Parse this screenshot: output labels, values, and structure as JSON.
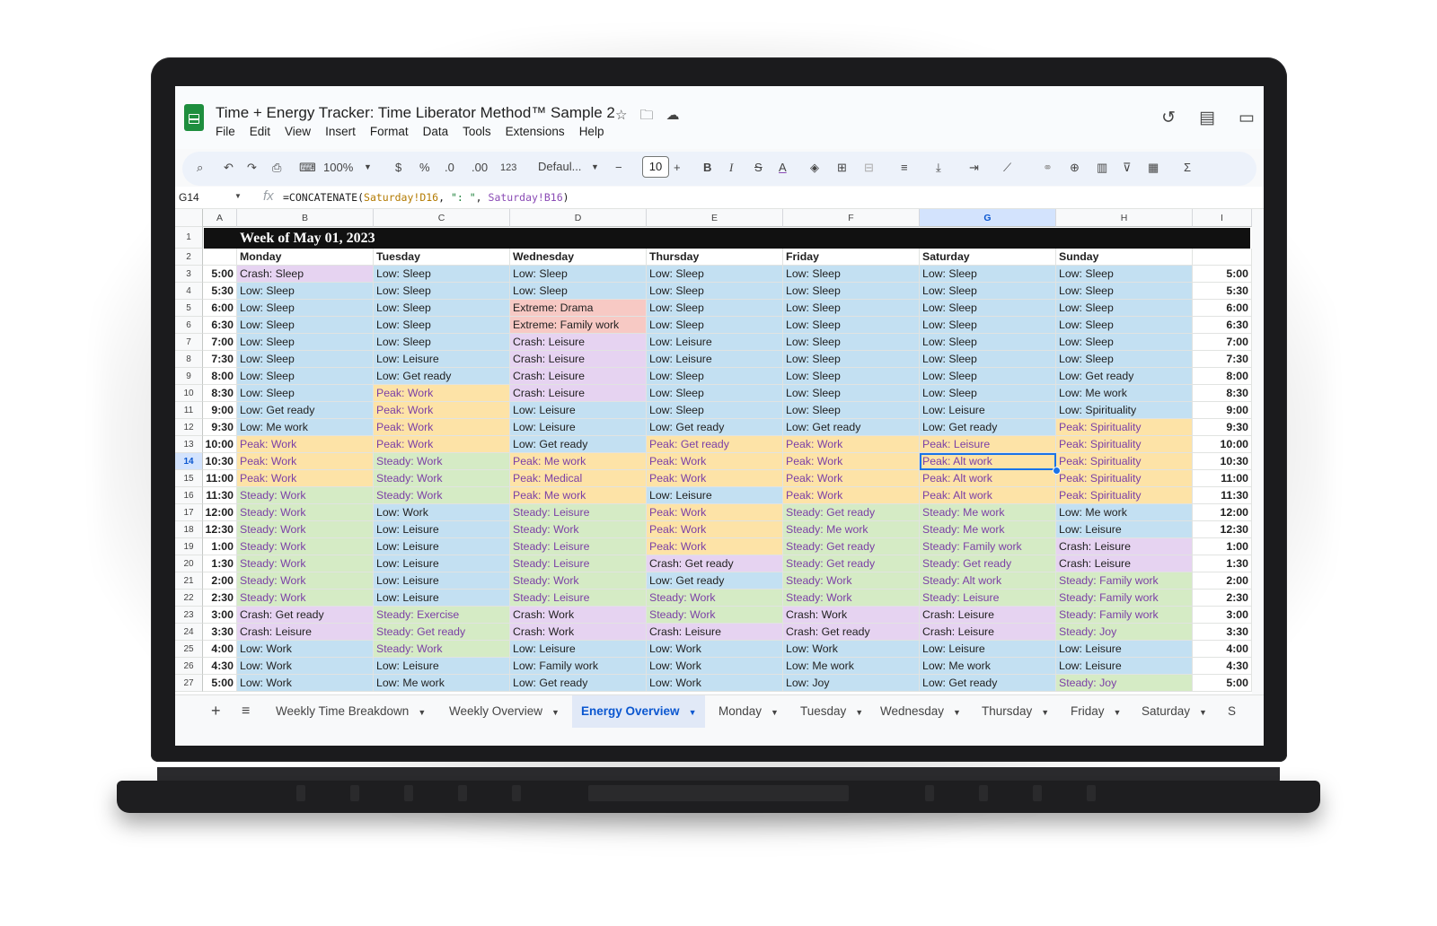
{
  "app": {
    "doc_title": "Time + Energy Tracker: Time Liberator Method™ Sample 2",
    "menu": [
      "File",
      "Edit",
      "View",
      "Insert",
      "Format",
      "Data",
      "Tools",
      "Extensions",
      "Help"
    ]
  },
  "toolbar": {
    "zoom": "100%",
    "currency": "$",
    "percent": "%",
    "decrease_decimal": ".0",
    "increase_decimal": ".00",
    "number_format": "123",
    "font": "Defaul...",
    "font_size": "10",
    "bold": "B",
    "italic": "I",
    "strike": "S",
    "text_color": "A",
    "sum": "Σ"
  },
  "formula_bar": {
    "name_box": "G14",
    "fx": "fx",
    "formula_prefix": "=CONCATENATE(",
    "ref1": "Saturday!D16",
    "sep1": ", ",
    "str": "\": \"",
    "sep2": ", ",
    "ref2": "Saturday!B16",
    "formula_suffix": ")"
  },
  "grid": {
    "columns": [
      "A",
      "B",
      "C",
      "D",
      "E",
      "F",
      "G",
      "H",
      "I"
    ],
    "selected_column": "G",
    "selected_row": "14",
    "banner": "Week of May 01, 2023",
    "days": [
      "Monday",
      "Tuesday",
      "Wednesday",
      "Thursday",
      "Friday",
      "Saturday",
      "Sunday"
    ],
    "rows": [
      {
        "n": "3",
        "time": "5:00",
        "cells": [
          "Crash: Sleep",
          "Low: Sleep",
          "Low: Sleep",
          "Low: Sleep",
          "Low: Sleep",
          "Low: Sleep",
          "Low: Sleep"
        ]
      },
      {
        "n": "4",
        "time": "5:30",
        "cells": [
          "Low: Sleep",
          "Low: Sleep",
          "Low: Sleep",
          "Low: Sleep",
          "Low: Sleep",
          "Low: Sleep",
          "Low: Sleep"
        ]
      },
      {
        "n": "5",
        "time": "6:00",
        "cells": [
          "Low: Sleep",
          "Low: Sleep",
          "Extreme: Drama",
          "Low: Sleep",
          "Low: Sleep",
          "Low: Sleep",
          "Low: Sleep"
        ]
      },
      {
        "n": "6",
        "time": "6:30",
        "cells": [
          "Low: Sleep",
          "Low: Sleep",
          "Extreme: Family work",
          "Low: Sleep",
          "Low: Sleep",
          "Low: Sleep",
          "Low: Sleep"
        ]
      },
      {
        "n": "7",
        "time": "7:00",
        "cells": [
          "Low: Sleep",
          "Low: Sleep",
          "Crash: Leisure",
          "Low: Leisure",
          "Low: Sleep",
          "Low: Sleep",
          "Low: Sleep"
        ]
      },
      {
        "n": "8",
        "time": "7:30",
        "cells": [
          "Low: Sleep",
          "Low: Leisure",
          "Crash: Leisure",
          "Low: Leisure",
          "Low: Sleep",
          "Low: Sleep",
          "Low: Sleep"
        ]
      },
      {
        "n": "9",
        "time": "8:00",
        "cells": [
          "Low: Sleep",
          "Low: Get ready",
          "Crash: Leisure",
          "Low: Sleep",
          "Low: Sleep",
          "Low: Sleep",
          "Low: Get ready"
        ]
      },
      {
        "n": "10",
        "time": "8:30",
        "cells": [
          "Low: Sleep",
          "Peak: Work",
          "Crash: Leisure",
          "Low: Sleep",
          "Low: Sleep",
          "Low: Sleep",
          "Low: Me work"
        ]
      },
      {
        "n": "11",
        "time": "9:00",
        "cells": [
          "Low: Get ready",
          "Peak: Work",
          "Low: Leisure",
          "Low: Sleep",
          "Low: Sleep",
          "Low: Leisure",
          "Low: Spirituality"
        ]
      },
      {
        "n": "12",
        "time": "9:30",
        "cells": [
          "Low: Me work",
          "Peak: Work",
          "Low: Leisure",
          "Low: Get ready",
          "Low: Get ready",
          "Low: Get ready",
          "Peak: Spirituality"
        ]
      },
      {
        "n": "13",
        "time": "10:00",
        "cells": [
          "Peak: Work",
          "Peak: Work",
          "Low: Get ready",
          "Peak: Get ready",
          "Peak: Work",
          "Peak: Leisure",
          "Peak: Spirituality"
        ]
      },
      {
        "n": "14",
        "time": "10:30",
        "cells": [
          "Peak: Work",
          "Steady: Work",
          "Peak: Me work",
          "Peak: Work",
          "Peak: Work",
          "Peak: Alt work",
          "Peak: Spirituality"
        ]
      },
      {
        "n": "15",
        "time": "11:00",
        "cells": [
          "Peak: Work",
          "Steady: Work",
          "Peak: Medical",
          "Peak: Work",
          "Peak: Work",
          "Peak: Alt work",
          "Peak: Spirituality"
        ]
      },
      {
        "n": "16",
        "time": "11:30",
        "cells": [
          "Steady: Work",
          "Steady: Work",
          "Peak: Me work",
          "Low: Leisure",
          "Peak: Work",
          "Peak: Alt work",
          "Peak: Spirituality"
        ]
      },
      {
        "n": "17",
        "time": "12:00",
        "cells": [
          "Steady: Work",
          "Low: Work",
          "Steady: Leisure",
          "Peak: Work",
          "Steady: Get ready",
          "Steady: Me work",
          "Low: Me work"
        ]
      },
      {
        "n": "18",
        "time": "12:30",
        "cells": [
          "Steady: Work",
          "Low: Leisure",
          "Steady: Work",
          "Peak: Work",
          "Steady: Me work",
          "Steady: Me work",
          "Low: Leisure"
        ]
      },
      {
        "n": "19",
        "time": "1:00",
        "cells": [
          "Steady: Work",
          "Low: Leisure",
          "Steady: Leisure",
          "Peak: Work",
          "Steady: Get ready",
          "Steady: Family work",
          "Crash: Leisure"
        ]
      },
      {
        "n": "20",
        "time": "1:30",
        "cells": [
          "Steady: Work",
          "Low: Leisure",
          "Steady: Leisure",
          "Crash: Get ready",
          "Steady: Get ready",
          "Steady: Get ready",
          "Crash: Leisure"
        ]
      },
      {
        "n": "21",
        "time": "2:00",
        "cells": [
          "Steady: Work",
          "Low: Leisure",
          "Steady: Work",
          "Low: Get ready",
          "Steady: Work",
          "Steady: Alt work",
          "Steady: Family work"
        ]
      },
      {
        "n": "22",
        "time": "2:30",
        "cells": [
          "Steady: Work",
          "Low: Leisure",
          "Steady: Leisure",
          "Steady: Work",
          "Steady: Work",
          "Steady: Leisure",
          "Steady: Family work"
        ]
      },
      {
        "n": "23",
        "time": "3:00",
        "cells": [
          "Crash: Get ready",
          "Steady: Exercise",
          "Crash: Work",
          "Steady: Work",
          "Crash: Work",
          "Crash: Leisure",
          "Steady: Family work"
        ]
      },
      {
        "n": "24",
        "time": "3:30",
        "cells": [
          "Crash: Leisure",
          "Steady: Get ready",
          "Crash: Work",
          "Crash: Leisure",
          "Crash: Get ready",
          "Crash: Leisure",
          "Steady: Joy"
        ]
      },
      {
        "n": "25",
        "time": "4:00",
        "cells": [
          "Low: Work",
          "Steady: Work",
          "Low: Leisure",
          "Low: Work",
          "Low: Work",
          "Low: Leisure",
          "Low: Leisure"
        ]
      },
      {
        "n": "26",
        "time": "4:30",
        "cells": [
          "Low: Work",
          "Low: Leisure",
          "Low: Family work",
          "Low: Work",
          "Low: Me work",
          "Low: Me work",
          "Low: Leisure"
        ]
      },
      {
        "n": "27",
        "time": "5:00",
        "cells": [
          "Low: Work",
          "Low: Me work",
          "Low: Get ready",
          "Low: Work",
          "Low: Joy",
          "Low: Get ready",
          "Steady: Joy"
        ]
      }
    ]
  },
  "energy_colors": {
    "Low": {
      "bg": "#c3e0f2",
      "fg": "#1f1f1f"
    },
    "Peak": {
      "bg": "#fde3a7",
      "fg": "#7b3fa6"
    },
    "Steady": {
      "bg": "#d5ebc5",
      "fg": "#7b3fa6"
    },
    "Crash": {
      "bg": "#e6d3f1",
      "fg": "#1f1f1f"
    },
    "Extreme": {
      "bg": "#f7c9c4",
      "fg": "#1f1f1f"
    }
  },
  "sheets": {
    "tabs": [
      "Weekly Time Breakdown",
      "Weekly Overview",
      "Energy Overview",
      "Monday",
      "Tuesday",
      "Wednesday",
      "Thursday",
      "Friday",
      "Saturday"
    ],
    "active": "Energy Overview",
    "overflow": "S"
  }
}
